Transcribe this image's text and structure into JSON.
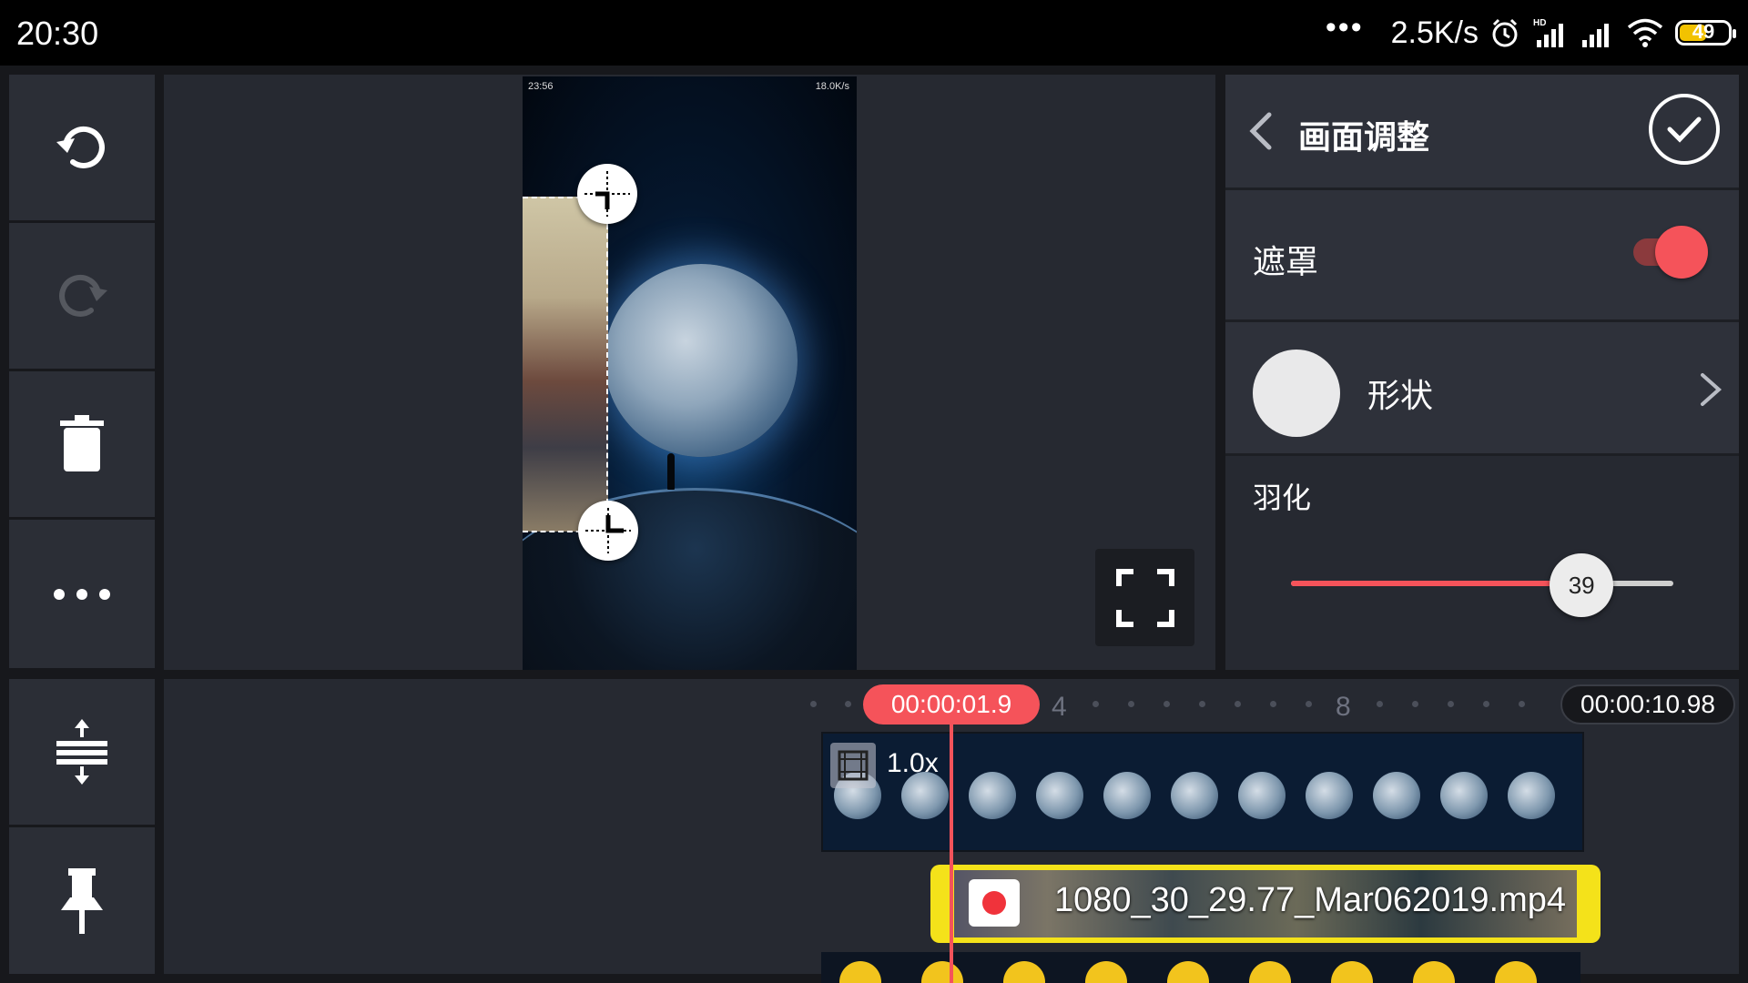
{
  "status_bar": {
    "time": "20:30",
    "dots": "•••",
    "speed": "2.5K/s",
    "battery": "49"
  },
  "left_tools": [
    {
      "name": "undo",
      "icon": "undo-icon"
    },
    {
      "name": "redo",
      "icon": "redo-icon"
    },
    {
      "name": "delete",
      "icon": "trash-icon"
    },
    {
      "name": "more",
      "icon": "more-icon"
    }
  ],
  "bottom_tools": [
    {
      "name": "expand-tracks",
      "icon": "expand-vertical-icon"
    },
    {
      "name": "pin",
      "icon": "pin-icon"
    }
  ],
  "preview": {
    "inner_time": "23:56",
    "inner_status": "18.0K/s"
  },
  "settings": {
    "title": "画面调整",
    "mask_label": "遮罩",
    "mask_enabled": true,
    "shape_label": "形状",
    "feather_label": "羽化",
    "feather_value": "39",
    "feather_fraction": 0.76
  },
  "timeline": {
    "current_time": "00:00:01.9",
    "total_time": "00:00:10.98",
    "ticks": [
      "4",
      "8"
    ],
    "main_clip_speed": "1.0x",
    "overlay_clip_name": "1080_30_29.77_Mar062019.mp4"
  },
  "colors": {
    "accent": "#f5535a",
    "overlay_clip": "#f4e21a"
  }
}
